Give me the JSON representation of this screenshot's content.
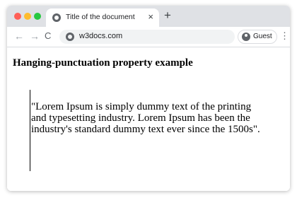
{
  "browser": {
    "tab": {
      "title": "Title of the document",
      "close_glyph": "×",
      "favicon": "globe-icon"
    },
    "new_tab_glyph": "+",
    "toolbar": {
      "back_glyph": "←",
      "forward_glyph": "→",
      "reload_glyph": "C",
      "url": "w3docs.com",
      "profile_label": "Guest",
      "menu_glyph": "⋮"
    },
    "traffic_light_colors": [
      "#ff5f57",
      "#febc2e",
      "#28c840"
    ]
  },
  "page": {
    "heading": "Hanging-punctuation property example",
    "paragraph": "\"Lorem Ipsum is simply dummy text of the printing and typesetting industry. Lorem Ipsum has been the industry's standard dummy text ever since the 1500s\"."
  }
}
